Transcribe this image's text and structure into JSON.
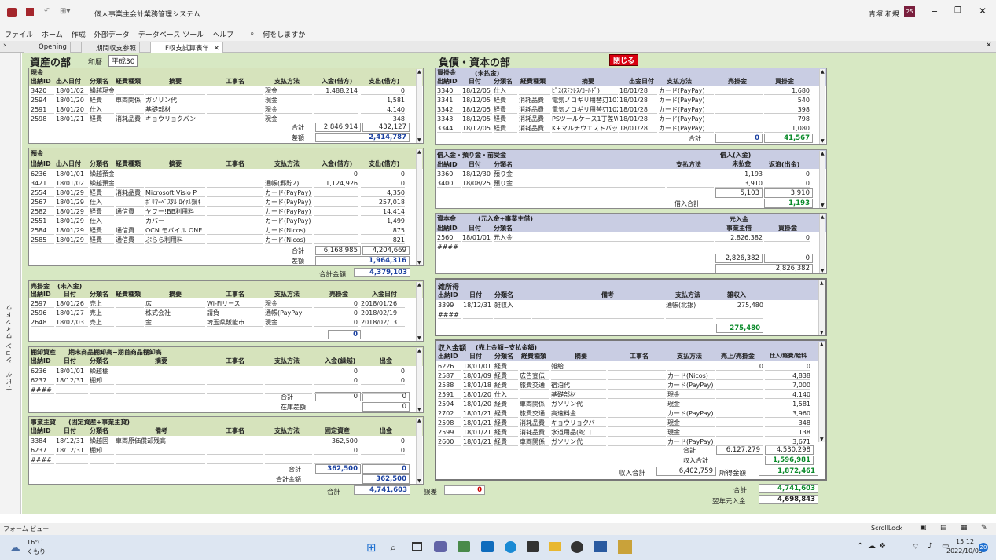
{
  "app": {
    "title": "個人事業主会計業務管理システム",
    "user": "青塚 和規",
    "user_badge": "25",
    "search": "何をしますか"
  },
  "ribbon": [
    "ファイル",
    "ホーム",
    "作成",
    "外部データ",
    "データベース ツール",
    "ヘルプ"
  ],
  "tabs": [
    "Opening",
    "期間収支参照",
    "F収支試算表年"
  ],
  "nav_label": "ナビゲーション ウィンドウ",
  "assets": {
    "title": "資産の部",
    "era_label": "和暦",
    "era_value": "平成30"
  },
  "liab": {
    "title": "負債・資本の部",
    "close": "閉じる"
  },
  "cash": {
    "title": "現金",
    "headers": [
      "出納ID",
      "出入日付",
      "分類名",
      "経費種類",
      "摘要",
      "工事名",
      "支払方法",
      "入金(借方)",
      "支出(借方)"
    ],
    "rows": [
      [
        "3420",
        "18/01/02",
        "繰越現金",
        "",
        "",
        "",
        "現金",
        "1,488,214",
        "0"
      ],
      [
        "2594",
        "18/01/20",
        "経費",
        "車両関係",
        "ガソリン代",
        "",
        "現金",
        "",
        "1,581"
      ],
      [
        "2591",
        "18/01/20",
        "仕入",
        "",
        "基礎部材",
        "",
        "現金",
        "",
        "4,140"
      ],
      [
        "2598",
        "18/01/21",
        "経費",
        "消耗品費",
        "キョウリョクバン",
        "",
        "現金",
        "",
        "348"
      ]
    ],
    "sum_label": "合計",
    "sum_in": "2,846,914",
    "sum_out": "432,127",
    "diff_label": "差額",
    "diff": "2,414,787"
  },
  "deposit": {
    "title": "預金",
    "headers": [
      "出納ID",
      "出入日付",
      "分類名",
      "経費種類",
      "摘要",
      "工事名",
      "支払方法",
      "入金(借方)",
      "支出(借方)"
    ],
    "rows": [
      [
        "6236",
        "18/01/01",
        "繰越預金",
        "",
        "",
        "",
        "",
        "0",
        "0"
      ],
      [
        "3421",
        "18/01/02",
        "繰越預金",
        "",
        "",
        "",
        "通帳(郵貯2)",
        "1,124,926",
        "0"
      ],
      [
        "2554",
        "18/01/29",
        "経費",
        "消耗品費",
        "Microsoft Visio P",
        "",
        "カード(PayPay)",
        "",
        "4,350"
      ],
      [
        "2567",
        "18/01/29",
        "仕入",
        "",
        "ﾎﾟﾘﾏｰﾍﾟｽﾀﾙ ﾛｲﾔﾙ鋼ｷ",
        "",
        "カード(PayPay)",
        "",
        "257,018"
      ],
      [
        "2582",
        "18/01/29",
        "経費",
        "通信費",
        "ヤフー!BB利用料",
        "",
        "カード(PayPay)",
        "",
        "14,414"
      ],
      [
        "2551",
        "18/01/29",
        "仕入",
        "",
        "カバー",
        "",
        "カード(PayPay)",
        "",
        "1,499"
      ],
      [
        "2584",
        "18/01/29",
        "経費",
        "通信費",
        "OCN モバイル ONE",
        "",
        "カード(Nicos)",
        "",
        "875"
      ],
      [
        "2585",
        "18/01/29",
        "経費",
        "通信費",
        "ぷらら利用料",
        "",
        "カード(Nicos)",
        "",
        "821"
      ]
    ],
    "sum_label": "合計",
    "sum_in": "6,168,985",
    "sum_out": "4,204,669",
    "diff_label": "差額",
    "diff": "1,964,316",
    "total_label": "合計金額",
    "total": "4,379,103"
  },
  "receivable": {
    "title": "売掛金",
    "sub": "(未入金)",
    "headers": [
      "出納ID",
      "日付",
      "分類名",
      "経費種類",
      "摘要",
      "工事名",
      "支払方法",
      "売掛金",
      "入金日付"
    ],
    "rows": [
      [
        "2597",
        "18/01/26",
        "売上",
        "",
        "広",
        "Wi-Fiリース",
        "現金",
        "0",
        "2018/01/26"
      ],
      [
        "2596",
        "18/01/27",
        "売上",
        "",
        "株式会社",
        "請負",
        "通帳(PayPay",
        "0",
        "2018/02/19"
      ],
      [
        "2648",
        "18/02/03",
        "売上",
        "",
        "金",
        "埼玉県飯能市",
        "現金",
        "0",
        "2018/02/13"
      ]
    ],
    "sum": "0"
  },
  "inventory": {
    "title": "棚卸資産",
    "sub": "期末商品棚卸高−期首商品棚卸高",
    "headers": [
      "出納ID",
      "日付",
      "分類名",
      "摘要",
      "工事名",
      "支払方法",
      "入金(繰越)",
      "出金"
    ],
    "rows": [
      [
        "6236",
        "18/01/01",
        "繰越棚",
        "",
        "",
        "",
        "0",
        "0"
      ],
      [
        "6237",
        "18/12/31",
        "棚卸",
        "",
        "",
        "",
        "0",
        "0"
      ],
      [
        "####",
        "",
        "",
        "",
        "",
        "",
        "",
        ""
      ]
    ],
    "sum_label": "合計",
    "sum_in": "0",
    "sum_out": "0",
    "stock_label": "在庫差額",
    "stock": "0"
  },
  "capital_asset": {
    "title": "事業主貸",
    "sub": "(固定資産+事業主貸)",
    "headers": [
      "出納ID",
      "日付",
      "分類名",
      "備考",
      "工事名",
      "支払方法",
      "固定資産",
      "出金"
    ],
    "rows": [
      [
        "3384",
        "18/12/31",
        "繰越固",
        "車両原価償却残高",
        "",
        "",
        "362,500",
        "0"
      ],
      [
        "6237",
        "18/12/31",
        "棚卸",
        "",
        "",
        "",
        "0",
        "0"
      ],
      [
        "####",
        "",
        "",
        "",
        "",
        "",
        "",
        ""
      ]
    ],
    "sum_label": "合計",
    "sum_in": "362,500",
    "sum_out": "0",
    "total_label": "合計金額",
    "total": "362,500"
  },
  "asset_total": {
    "label": "合計",
    "value": "4,741,603",
    "err_label": "誤差",
    "err": "0"
  },
  "payable": {
    "title": "買掛金",
    "sub": "(未払金)",
    "headers": [
      "出納ID",
      "日付",
      "分類名",
      "経費種類",
      "摘要",
      "出金日付",
      "支払方法",
      "売掛金",
      "買掛金"
    ],
    "rows": [
      [
        "3340",
        "18/12/05",
        "仕入",
        "",
        "ﾋﾟｽ(ｽﾃﾝﾚｽ/ｺｰﾙﾄﾞ)",
        "18/01/28",
        "カード(PayPay)",
        "",
        "1,680"
      ],
      [
        "3341",
        "18/12/05",
        "経費",
        "消耗品費",
        "電気ノコギリ用替刃101",
        "18/01/28",
        "カード(PayPay)",
        "",
        "540"
      ],
      [
        "3342",
        "18/12/05",
        "経費",
        "消耗品費",
        "電気ノコギリ用替刃102",
        "18/01/28",
        "カード(PayPay)",
        "",
        "398"
      ],
      [
        "3343",
        "18/12/05",
        "経費",
        "消耗品費",
        "PSツールケース1丁差WP",
        "18/01/28",
        "カード(PayPay)",
        "",
        "798"
      ],
      [
        "3344",
        "18/12/05",
        "経費",
        "消耗品費",
        "K+マルチウエストバッグ",
        "18/01/28",
        "カード(PayPay)",
        "",
        "1,080"
      ]
    ],
    "sum_label": "合計",
    "sum_a": "0",
    "sum_b": "41,567"
  },
  "borrow": {
    "title": "借入金・預り金・前受金",
    "headers": [
      "出納ID",
      "日付",
      "分類名",
      "支払方法",
      "借入(入金)\n未払金",
      "返済(出金)"
    ],
    "rows": [
      [
        "3360",
        "18/12/30",
        "預り金",
        "",
        "1,193",
        "0"
      ],
      [
        "3400",
        "18/08/25",
        "預り金",
        "",
        "3,910",
        "0"
      ]
    ],
    "sum_a": "5,103",
    "sum_b": "3,910",
    "total_label": "借入合計",
    "total": "1,193"
  },
  "capital": {
    "title": "資本金",
    "sub": "(元入金+事業主借)",
    "headers": [
      "出納ID",
      "日付",
      "分類名",
      "元入金\n事業主借",
      "買掛金"
    ],
    "rows": [
      [
        "2560",
        "18/01/01",
        "元入金",
        "2,826,382",
        "0"
      ],
      [
        "####",
        "",
        "",
        "",
        ""
      ]
    ],
    "sum_a": "2,826,382",
    "sum_b": "0",
    "total": "2,826,382"
  },
  "misc": {
    "title": "雑所得",
    "headers": [
      "出納ID",
      "日付",
      "分類名",
      "備考",
      "支払方法",
      "雑収入"
    ],
    "rows": [
      [
        "3399",
        "18/12/31",
        "雑収入",
        "",
        "通帳(北銀)",
        "275,480"
      ],
      [
        "####",
        "",
        "",
        "",
        "",
        ""
      ]
    ],
    "total": "275,480"
  },
  "income": {
    "title": "収入金額",
    "sub": "(売上金額−支払金額)",
    "headers": [
      "出納ID",
      "日付",
      "分類名",
      "経費種類",
      "摘要",
      "工事名",
      "支払方法",
      "売上/売掛金",
      "仕入/経費/給料"
    ],
    "rows": [
      [
        "6226",
        "18/01/01",
        "経費",
        "",
        "雑給",
        "",
        "",
        "0",
        "0"
      ],
      [
        "2587",
        "18/01/09",
        "経費",
        "広告宣伝",
        "",
        "",
        "カード(Nicos)",
        "",
        "4,838"
      ],
      [
        "2588",
        "18/01/18",
        "経費",
        "旅費交通",
        "宿泊代",
        "",
        "カード(PayPay)",
        "",
        "7,000"
      ],
      [
        "2591",
        "18/01/20",
        "仕入",
        "",
        "基礎部材",
        "",
        "現金",
        "",
        "4,140"
      ],
      [
        "2594",
        "18/01/20",
        "経費",
        "車両関係",
        "ガソリン代",
        "",
        "現金",
        "",
        "1,581"
      ],
      [
        "2702",
        "18/01/21",
        "経費",
        "旅費交通",
        "高速料金",
        "",
        "カード(PayPay)",
        "",
        "3,960"
      ],
      [
        "2598",
        "18/01/21",
        "経費",
        "消耗品費",
        "キョウリョクバ",
        "",
        "現金",
        "",
        "348"
      ],
      [
        "2599",
        "18/01/21",
        "経費",
        "消耗品費",
        "水道用品(蛇口",
        "",
        "現金",
        "",
        "138"
      ],
      [
        "2600",
        "18/01/21",
        "経費",
        "車両関係",
        "ガソリン代",
        "",
        "カード(PayPay)",
        "",
        "3,671"
      ]
    ],
    "sum_label": "合計",
    "sum_a": "6,127,279",
    "sum_b": "4,530,298",
    "inc_label": "収入合計",
    "inc": "1,596,981",
    "income_total_label": "収入合計",
    "income_total": "6,402,759",
    "profit_label": "所得金額",
    "profit": "1,872,461"
  },
  "liab_total": {
    "label": "合計",
    "value": "4,741,603",
    "next_label": "翌年元入金",
    "next": "4,698,843"
  },
  "status": {
    "left": "フォーム ビュー",
    "scroll": "ScrollLock"
  },
  "taskbar": {
    "temp": "16°C",
    "weather": "くもり",
    "time": "15:12",
    "date": "2022/10/05",
    "badge": "20"
  }
}
